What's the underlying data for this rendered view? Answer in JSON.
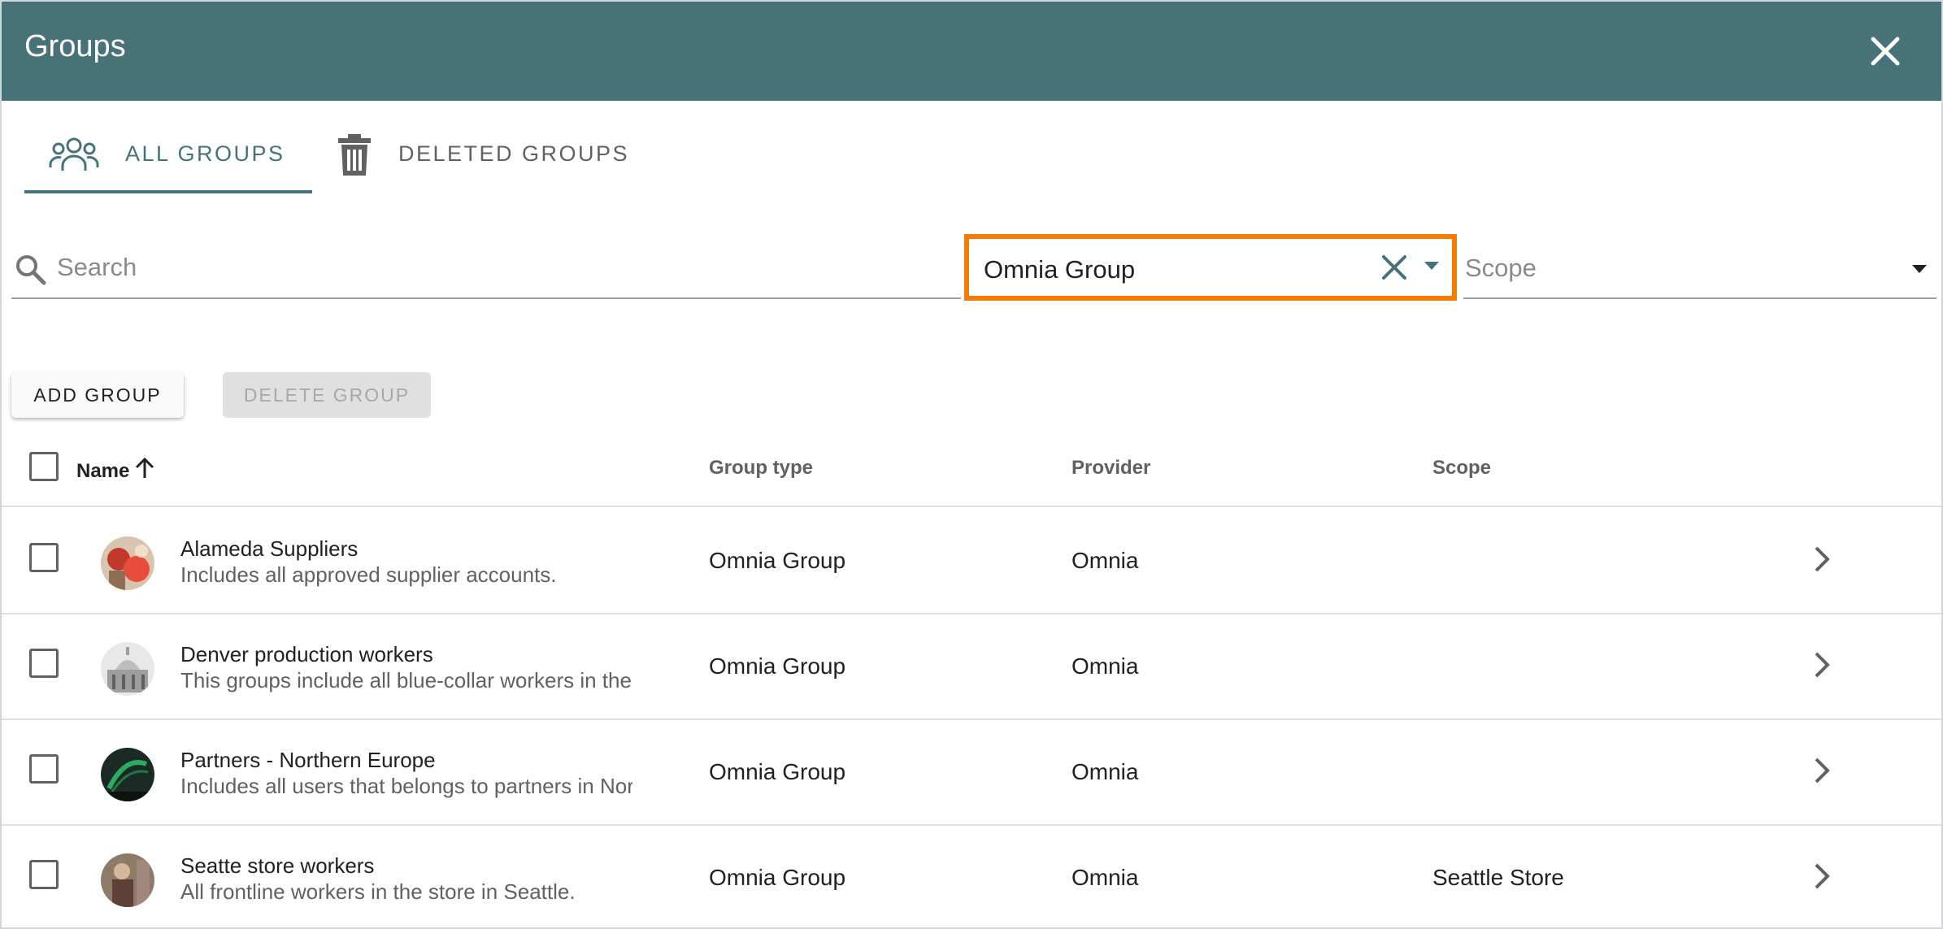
{
  "header": {
    "title": "Groups",
    "close_icon": "close-icon"
  },
  "tabs": [
    {
      "label": "ALL GROUPS",
      "icon": "people-group-icon",
      "active": true
    },
    {
      "label": "DELETED GROUPS",
      "icon": "trash-icon",
      "active": false
    }
  ],
  "search": {
    "placeholder": "Search",
    "value": ""
  },
  "group_type_filter": {
    "value": "Omnia Group",
    "highlight_color": "#f57c00"
  },
  "scope_filter": {
    "label": "Scope"
  },
  "buttons": {
    "add": "ADD GROUP",
    "delete": "DELETE GROUP"
  },
  "table": {
    "columns": {
      "name": "Name",
      "group_type": "Group type",
      "provider": "Provider",
      "scope": "Scope"
    },
    "sort": {
      "column": "name",
      "direction": "ascending"
    },
    "rows": [
      {
        "name": "Alameda Suppliers",
        "description": "Includes all approved supplier accounts.",
        "group_type": "Omnia Group",
        "provider": "Omnia",
        "scope": ""
      },
      {
        "name": "Denver production workers",
        "description": "This groups include all blue-collar workers in the Denver factory.",
        "group_type": "Omnia Group",
        "provider": "Omnia",
        "scope": ""
      },
      {
        "name": "Partners - Northern Europe",
        "description": "Includes all users that belongs to partners in Northern Europe.",
        "group_type": "Omnia Group",
        "provider": "Omnia",
        "scope": ""
      },
      {
        "name": "Seatte store workers",
        "description": "All frontline workers in the store in Seattle.",
        "group_type": "Omnia Group",
        "provider": "Omnia",
        "scope": "Seattle Store"
      }
    ]
  },
  "colors": {
    "header_bg": "#477278",
    "accent": "#477278",
    "highlight": "#f57c00"
  }
}
